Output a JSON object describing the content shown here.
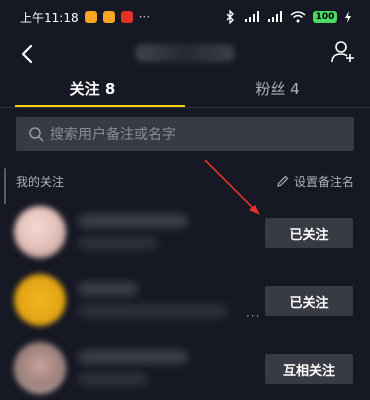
{
  "status_bar": {
    "time": "上午11:18",
    "battery": "100",
    "app_icon_colors": [
      "#f5a623",
      "#f5a623",
      "#e0332a"
    ]
  },
  "nav": {
    "back_icon": "chevron-left-icon",
    "add_user_icon": "add-user-icon"
  },
  "tabs": [
    {
      "label": "关注 8",
      "active": true
    },
    {
      "label": "粉丝 4",
      "active": false
    }
  ],
  "search": {
    "placeholder": "搜索用户备注或名字"
  },
  "section": {
    "title": "我的关注",
    "set_remark": "设置备注名"
  },
  "users": [
    {
      "button": "已关注"
    },
    {
      "button": "已关注"
    },
    {
      "button": "互相关注"
    }
  ],
  "colors": {
    "background": "#161823",
    "accent": "#face15",
    "button_bg": "#393b44",
    "arrow": "#e0332a"
  }
}
